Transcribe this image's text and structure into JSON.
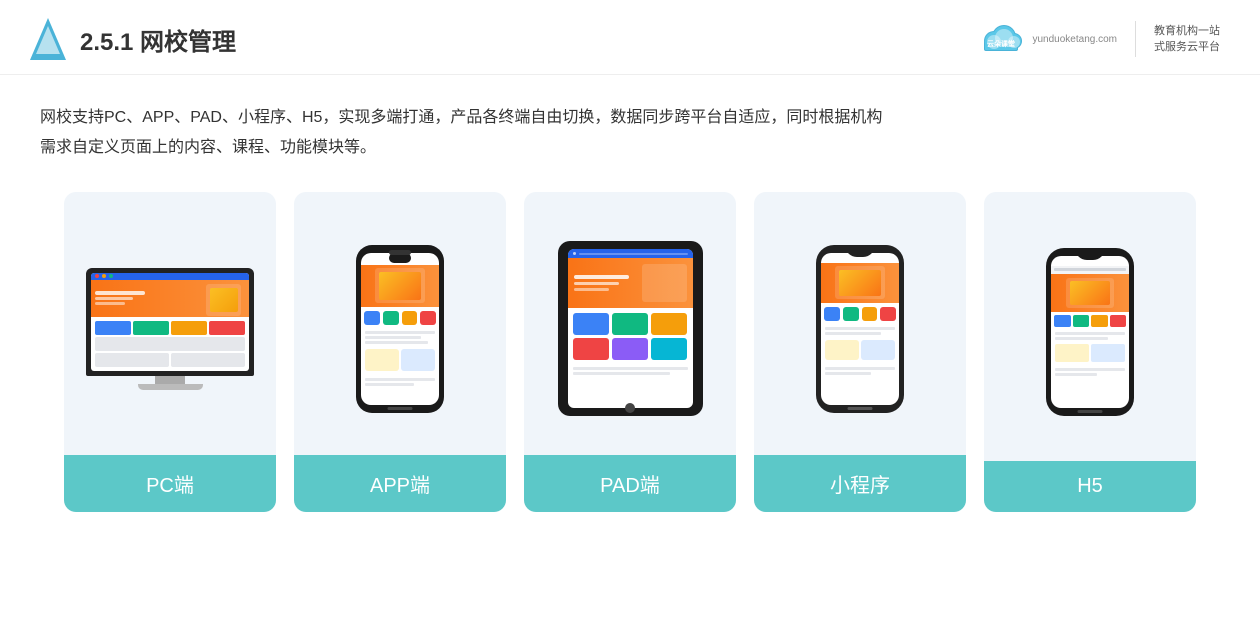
{
  "header": {
    "title_prefix": "2.5.1 ",
    "title_bold": "网校管理",
    "brand": {
      "name": "云朵课堂",
      "domain": "yunduoketang.com",
      "tagline_line1": "教育机构一站",
      "tagline_line2": "式服务云平台"
    }
  },
  "description": {
    "text_line1": "网校支持PC、APP、PAD、小程序、H5，实现多端打通，产品各终端自由切换，数据同步跨平台自适应，同时根据机构",
    "text_line2": "需求自定义页面上的内容、课程、功能模块等。"
  },
  "platforms": [
    {
      "id": "pc",
      "label": "PC端"
    },
    {
      "id": "app",
      "label": "APP端"
    },
    {
      "id": "pad",
      "label": "PAD端"
    },
    {
      "id": "miniapp",
      "label": "小程序"
    },
    {
      "id": "h5",
      "label": "H5"
    }
  ],
  "colors": {
    "accent": "#5cc8c8",
    "card_bg": "#edf3f9",
    "title_blue": "#4ab3d8"
  }
}
